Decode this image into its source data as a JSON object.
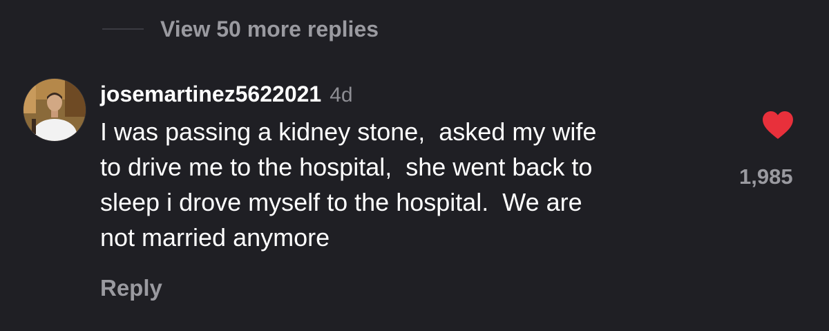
{
  "thread": {
    "view_more_label": "View 50 more replies"
  },
  "comment": {
    "username": "josemartinez5622021",
    "time_ago": "4d",
    "text_lines": [
      "I was passing a kidney stone,  asked my wife",
      "to drive me to the hospital,  she went back to",
      "sleep i drove myself to the hospital.  We are",
      "not married anymore"
    ],
    "reply_label": "Reply",
    "like_count": "1,985",
    "liked": true
  },
  "colors": {
    "background": "#1f1f24",
    "text_primary": "#ffffff",
    "text_secondary": "#9a9aa0",
    "heart": "#e8303b"
  },
  "icons": {
    "like": "heart-icon"
  }
}
